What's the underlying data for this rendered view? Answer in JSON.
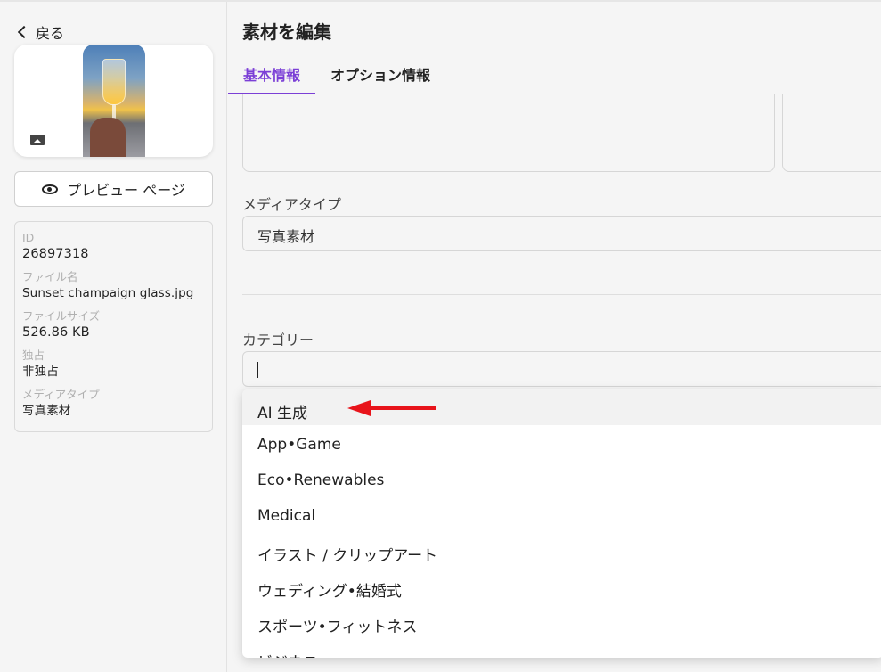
{
  "sidebar": {
    "back_label": "戻る",
    "preview_label": "プレビュー ページ",
    "info": [
      {
        "label": "ID",
        "value": "26897318"
      },
      {
        "label": "ファイル名",
        "value": "Sunset champaign glass.jpg"
      },
      {
        "label": "ファイルサイズ",
        "value": "526.86 KB"
      },
      {
        "label": "独占",
        "value": "非独占"
      },
      {
        "label": "メディアタイプ",
        "value": "写真素材"
      }
    ]
  },
  "main": {
    "title": "素材を編集",
    "tabs": [
      {
        "label": "基本情報",
        "active": true
      },
      {
        "label": "オプション情報",
        "active": false
      }
    ],
    "media_type": {
      "label": "メディアタイプ",
      "value": "写真素材"
    },
    "category": {
      "label": "カテゴリー",
      "value": ""
    },
    "dropdown_options": [
      "AI 生成",
      "App•Game",
      "Eco•Renewables",
      "Medical",
      "イラスト / クリップアート",
      "ウェディング•結婚式",
      "スポーツ•フィットネス",
      "ビジネス"
    ],
    "highlighted_option": "AI 生成"
  },
  "colors": {
    "accent": "#7b3fd6",
    "arrow": "#e8141b",
    "background": "#f5f5f5"
  }
}
